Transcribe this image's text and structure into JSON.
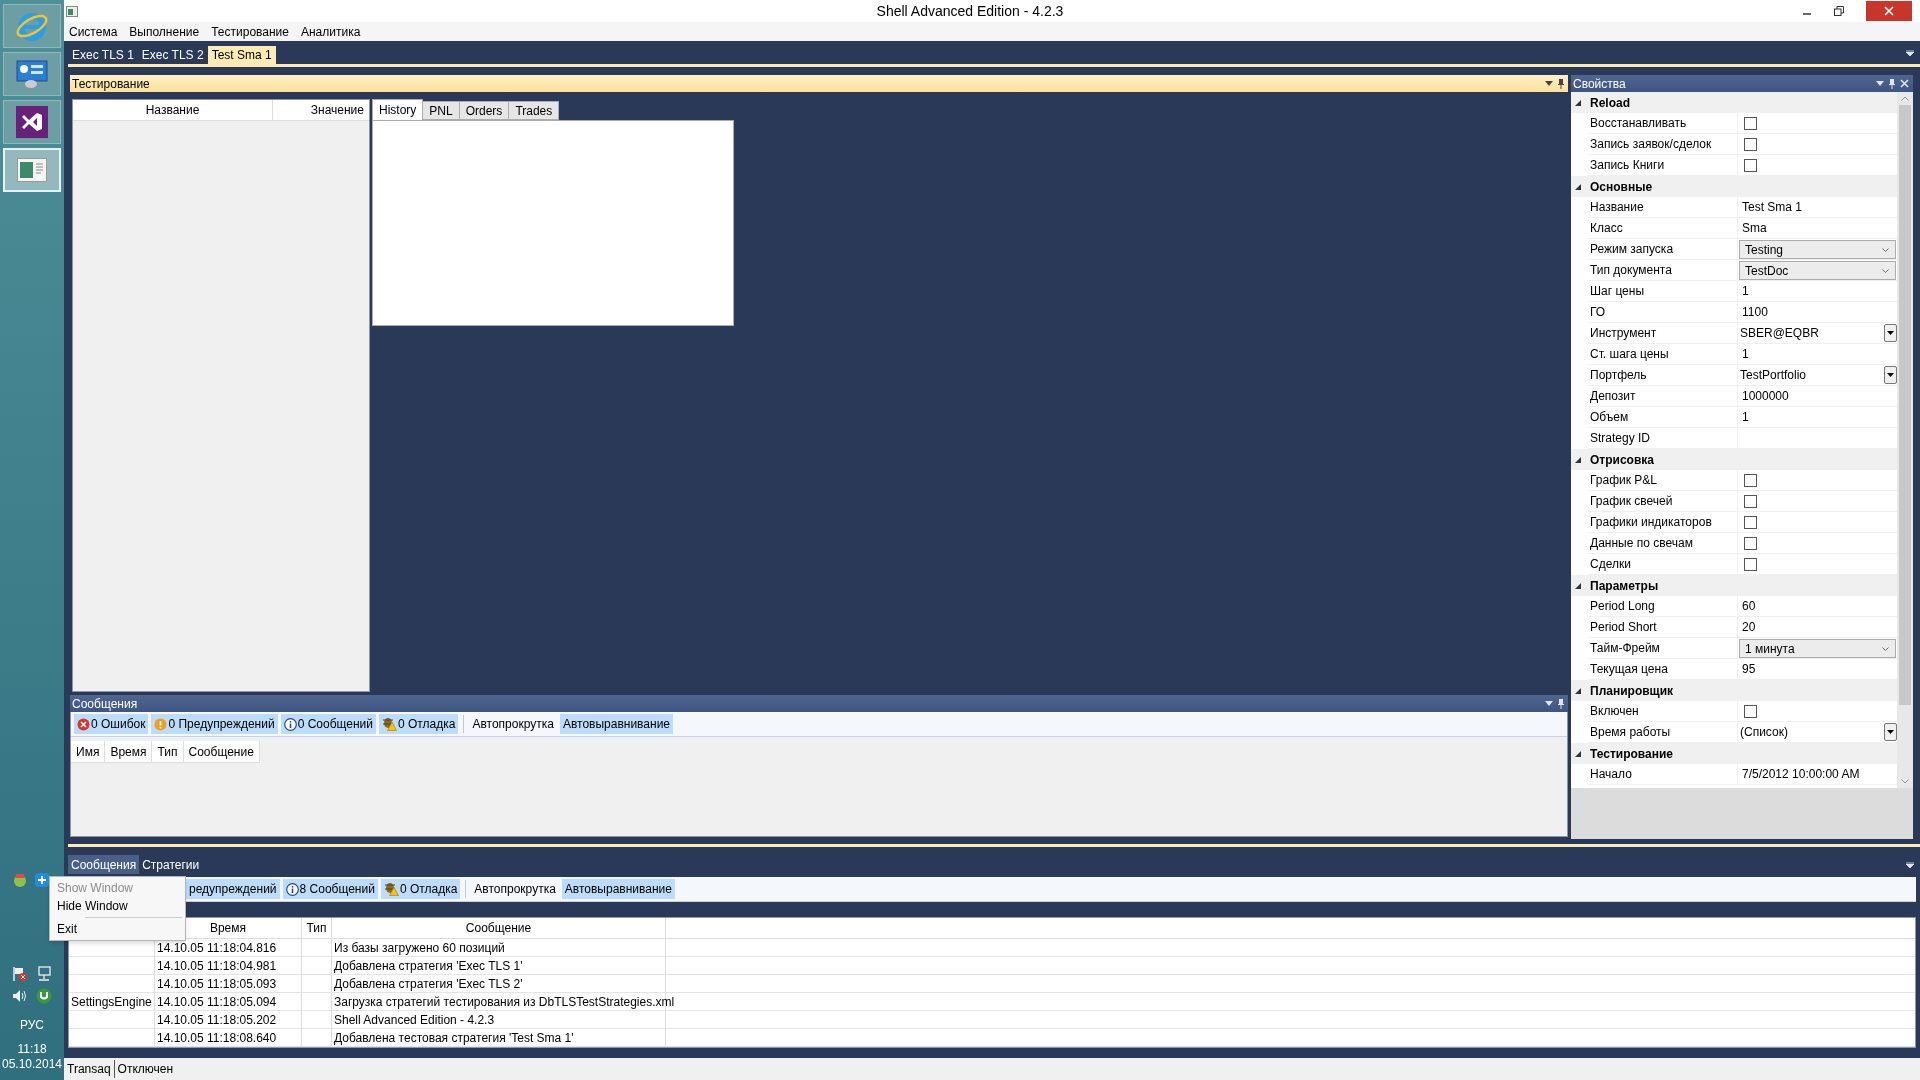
{
  "window": {
    "title": "Shell Advanced Edition - 4.2.3"
  },
  "menu": [
    "Система",
    "Выполнение",
    "Тестирование",
    "Аналитика"
  ],
  "doc_tabs": [
    {
      "label": "Exec TLS 1",
      "selected": false
    },
    {
      "label": "Exec TLS 2",
      "selected": false
    },
    {
      "label": "Test Sma 1",
      "selected": true
    }
  ],
  "testing_panel": {
    "title": "Тестирование",
    "grid_columns": [
      "Название",
      "Значение"
    ],
    "tabs": [
      {
        "label": "History",
        "selected": true
      },
      {
        "label": "PNL",
        "selected": false
      },
      {
        "label": "Orders",
        "selected": false
      },
      {
        "label": "Trades",
        "selected": false
      }
    ]
  },
  "messages_panel": {
    "title": "Сообщения",
    "filters": [
      {
        "kind": "error",
        "label": "0 Ошибок",
        "pressed": true
      },
      {
        "kind": "warning",
        "label": "0 Предупреждений",
        "pressed": true
      },
      {
        "kind": "info",
        "label": "0 Сообщений",
        "pressed": true
      },
      {
        "kind": "debug",
        "label": "0 Отладка",
        "pressed": true
      },
      {
        "kind": "separator"
      },
      {
        "kind": "text",
        "label": "Автопрокрутка",
        "pressed": false
      },
      {
        "kind": "text",
        "label": "Автовыравнивание",
        "pressed": true
      }
    ],
    "columns": [
      "Имя",
      "Время",
      "Тип",
      "Сообщение"
    ]
  },
  "properties_panel": {
    "title": "Свойства",
    "groups": [
      {
        "title": "Reload",
        "rows": [
          {
            "label": "Восстанавливать",
            "kind": "checkbox",
            "checked": false
          },
          {
            "label": "Запись заявок/сделок",
            "kind": "checkbox",
            "checked": false
          },
          {
            "label": "Запись Книги",
            "kind": "checkbox",
            "checked": false
          }
        ]
      },
      {
        "title": "Основные",
        "rows": [
          {
            "label": "Название",
            "kind": "text",
            "value": "Test Sma 1"
          },
          {
            "label": "Класс",
            "kind": "text",
            "value": "Sma"
          },
          {
            "label": "Режим запуска",
            "kind": "dropdown",
            "value": "Testing"
          },
          {
            "label": "Тип документа",
            "kind": "dropdown",
            "value": "TestDoc"
          },
          {
            "label": "Шаг цены",
            "kind": "text",
            "value": "1"
          },
          {
            "label": "ГО",
            "kind": "text",
            "value": "1100"
          },
          {
            "label": "Инструмент",
            "kind": "picker",
            "value": "SBER@EQBR"
          },
          {
            "label": "Ст. шага цены",
            "kind": "text",
            "value": "1"
          },
          {
            "label": "Портфель",
            "kind": "picker",
            "value": "TestPortfolio"
          },
          {
            "label": "Депозит",
            "kind": "text",
            "value": "1000000"
          },
          {
            "label": "Объем",
            "kind": "text",
            "value": "1"
          },
          {
            "label": "Strategy ID",
            "kind": "text"
          }
        ]
      },
      {
        "title": "Отрисовка",
        "rows": [
          {
            "label": "График P&L",
            "kind": "checkbox",
            "checked": false
          },
          {
            "label": "График свечей",
            "kind": "checkbox",
            "checked": false
          },
          {
            "label": "Графики индикаторов",
            "kind": "checkbox",
            "checked": false
          },
          {
            "label": "Данные по свечам",
            "kind": "checkbox",
            "checked": false
          },
          {
            "label": "Сделки",
            "kind": "checkbox",
            "checked": false
          }
        ]
      },
      {
        "title": "Параметры",
        "rows": [
          {
            "label": "Period Long",
            "kind": "text",
            "value": "60"
          },
          {
            "label": "Period Short",
            "kind": "text",
            "value": "20"
          },
          {
            "label": "Тайм-Фрейм",
            "kind": "dropdown",
            "value": "1 минута"
          },
          {
            "label": "Текущая цена",
            "kind": "text",
            "value": "95"
          }
        ]
      },
      {
        "title": "Планировщик",
        "rows": [
          {
            "label": "Включен",
            "kind": "checkbox",
            "checked": false
          },
          {
            "label": "Время работы",
            "kind": "picker",
            "value": "(Список)"
          }
        ]
      },
      {
        "title": "Тестирование",
        "rows": [
          {
            "label": "Начало",
            "kind": "text",
            "value": "7/5/2012 10:00:00 AM"
          }
        ]
      }
    ]
  },
  "bottom_panel": {
    "tabs": [
      {
        "label": "Сообщения",
        "selected": true
      },
      {
        "label": "Стратегии",
        "selected": false
      }
    ],
    "filters": [
      {
        "kind": "text",
        "label": "редупреждений",
        "pressed": true
      },
      {
        "kind": "info",
        "label": "8 Сообщений",
        "pressed": true
      },
      {
        "kind": "debug",
        "label": "0 Отладка",
        "pressed": true
      },
      {
        "kind": "separator"
      },
      {
        "kind": "text",
        "label": "Автопрокрутка",
        "pressed": false
      },
      {
        "kind": "text",
        "label": "Автовыравнивание",
        "pressed": true
      }
    ],
    "columns": [
      "Время",
      "Тип",
      "Сообщение"
    ],
    "rows": [
      {
        "time": "14.10.05 11:18:04.816",
        "message": "Из базы загружено 60 позиций"
      },
      {
        "time": "14.10.05 11:18:04.981",
        "message": "Добавлена стратегия 'Exec TLS 1'"
      },
      {
        "time": "14.10.05 11:18:05.093",
        "message": "Добавлена стратегия 'Exec TLS 2'"
      },
      {
        "name": "SettingsEngine",
        "time": "14.10.05 11:18:05.094",
        "message": "Загрузка стратегий тестирования из DbTLSTestStrategies.xml"
      },
      {
        "time": "14.10.05 11:18:05.202",
        "message": "Shell Advanced Edition - 4.2.3"
      },
      {
        "time": "14.10.05 11:18:08.640",
        "message": "Добавлена тестовая стратегия 'Test Sma 1'"
      }
    ]
  },
  "status_bar": [
    "Transaq",
    "Отключен"
  ],
  "context_menu": [
    {
      "kind": "item",
      "label": "Show Window",
      "disabled": true
    },
    {
      "kind": "item",
      "label": "Hide Window",
      "disabled": false
    },
    {
      "kind": "separator"
    },
    {
      "kind": "item",
      "label": "Exit",
      "disabled": false
    }
  ],
  "taskbar": {
    "language": "РУС",
    "time": "11:18",
    "date": "05.10.2014"
  }
}
